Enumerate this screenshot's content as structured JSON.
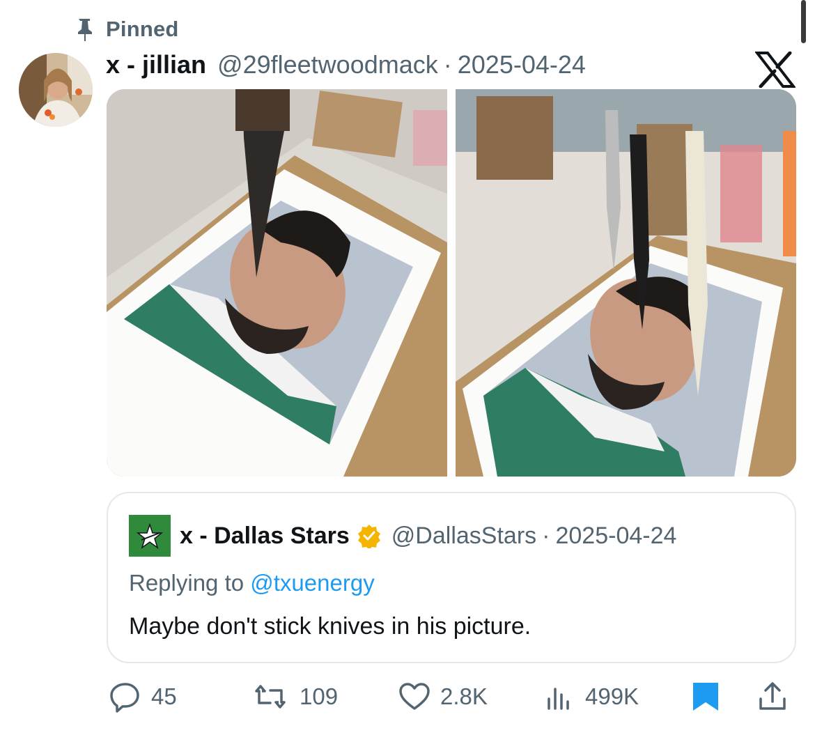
{
  "pinned": {
    "label": "Pinned",
    "icon": "pin-icon"
  },
  "tweet": {
    "display_name": "x - jillian",
    "handle": "@29fleetwoodmack",
    "separator": "·",
    "timestamp": "2025-04-24",
    "source_logo": "x-logo-icon"
  },
  "quote": {
    "display_name": "x - Dallas Stars",
    "verified": true,
    "handle": "@DallasStars",
    "separator": "·",
    "timestamp": "2025-04-24",
    "replying_prefix": "Replying to ",
    "replying_mention": "@txuenergy",
    "text": "Maybe don't stick knives in his picture."
  },
  "actions": {
    "replies": "45",
    "reposts": "109",
    "likes": "2.8K",
    "views": "499K"
  },
  "colors": {
    "muted": "#536471",
    "link": "#1d9bf0",
    "bookmark": "#1d9bf0",
    "verified_badge": "#f4b400",
    "stars_green": "#2f8a3c"
  }
}
